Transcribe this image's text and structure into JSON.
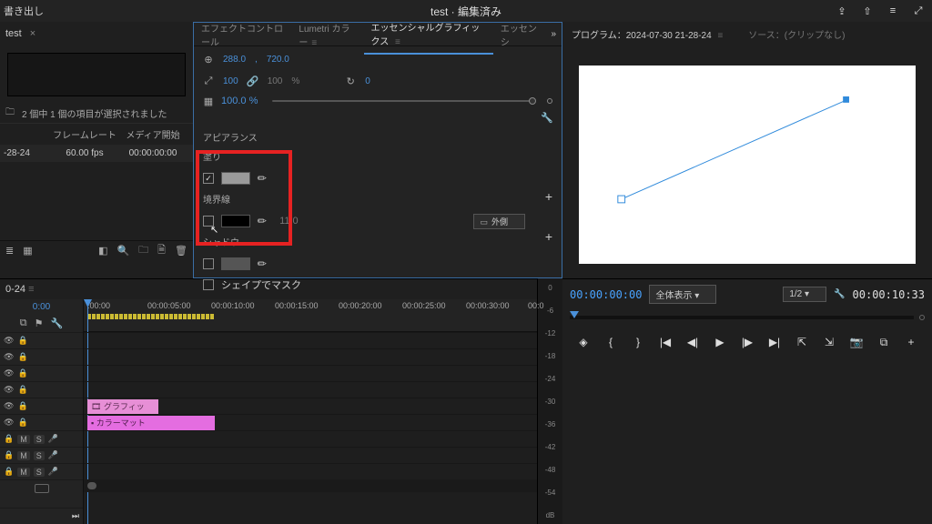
{
  "topbar": {
    "export": "書き出し",
    "title": "test · 編集済み"
  },
  "project": {
    "tab": "test",
    "selection_text": "2 個中 1 個の項目が選択されました",
    "headers": {
      "name": "",
      "fps": "フレームレート",
      "media_start": "メディア開始"
    },
    "row": {
      "name": "-28-24",
      "fps": "60.00 fps",
      "media_start": "00:00:00:00"
    }
  },
  "center": {
    "tabs": {
      "effect": "エフェクトコントロール",
      "lumetri": "Lumetri カラー",
      "eg": "エッセンシャルグラフィックス",
      "ess": "エッセンシ"
    },
    "pos": {
      "x": "288.0",
      "y": "720.0"
    },
    "scale": {
      "link": "100",
      "w": "100",
      "pct": "%",
      "rot": "0"
    },
    "opacity": "100.0 %",
    "appearance_label": "アピアランス",
    "fill_label": "塗り",
    "stroke_label": "境界線",
    "stroke_width": "11.0",
    "stroke_style": "外側",
    "shadow_label": "シャドウ",
    "mask_label": "シェイプでマスク"
  },
  "program": {
    "tab": "プログラム：2024-07-30 21-28-24",
    "source": "ソース：(クリップなし)"
  },
  "timeline": {
    "tab": "0-24",
    "tc": "0:00",
    "ticks": [
      ":00:00",
      "00:00:05:00",
      "00:00:10:00",
      "00:00:15:00",
      "00:00:20:00",
      "00:00:25:00",
      "00:00:30:00",
      "00:0"
    ],
    "clip_graphic": "グラフィッ",
    "clip_matte": "カラーマット",
    "audio_labels": [
      "M",
      "S"
    ]
  },
  "meters": [
    "0",
    "-6",
    "-12",
    "-18",
    "-24",
    "-30",
    "-36",
    "-42",
    "-48",
    "-54",
    "dB"
  ],
  "prog_ctrl": {
    "tc_in": "00:00:00:00",
    "fit": "全体表示",
    "res": "1/2",
    "tc_out": "00:00:10:33"
  }
}
